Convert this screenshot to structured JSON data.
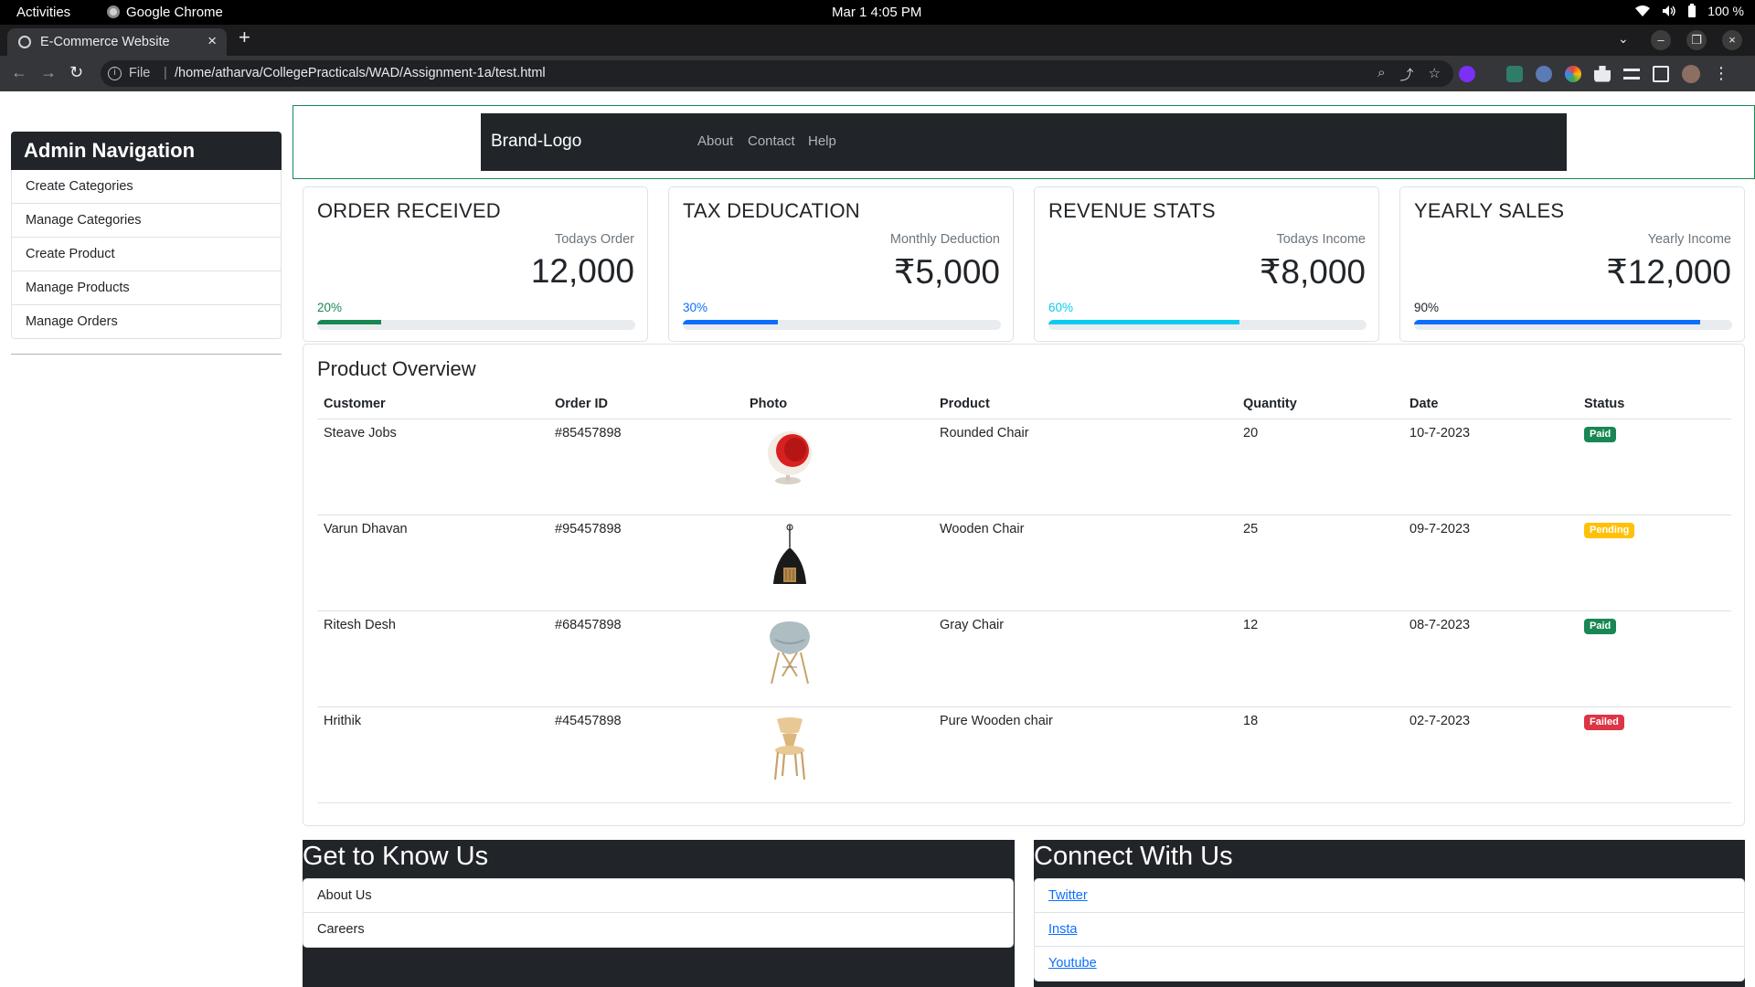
{
  "os": {
    "activities": "Activities",
    "app_name": "Google Chrome",
    "datetime": "Mar 1  4:05 PM",
    "battery": "100 %"
  },
  "browser": {
    "tab_title": "E-Commerce Website",
    "file_label": "File",
    "url": "/home/atharva/CollegePracticals/WAD/Assignment-1a/test.html"
  },
  "sidebar": {
    "title": "Admin Navigation",
    "items": [
      {
        "label": "Create Categories"
      },
      {
        "label": "Manage Categories"
      },
      {
        "label": "Create Product"
      },
      {
        "label": "Manage Products"
      },
      {
        "label": "Manage Orders"
      }
    ]
  },
  "navbar": {
    "brand": "Brand-Logo",
    "links": [
      "About",
      "Contact",
      "Help"
    ]
  },
  "cards": [
    {
      "title": "ORDER RECEIVED",
      "subtitle": "Todays Order",
      "value": "12,000",
      "percent_label": "20%",
      "percent": 20,
      "color": "#198754"
    },
    {
      "title": "TAX DEDUCATION",
      "subtitle": "Monthly Deduction",
      "value": "₹5,000",
      "percent_label": "30%",
      "percent": 30,
      "color": "#0d6efd"
    },
    {
      "title": "REVENUE STATS",
      "subtitle": "Todays Income",
      "value": "₹8,000",
      "percent_label": "60%",
      "percent": 60,
      "color": "#0dcaf0"
    },
    {
      "title": "YEARLY SALES",
      "subtitle": "Yearly Income",
      "value": "₹12,000",
      "percent_label": "90%",
      "percent": 90,
      "color": "#0d6efd"
    }
  ],
  "overview": {
    "title": "Product Overview",
    "columns": [
      "Customer",
      "Order ID",
      "Photo",
      "Product",
      "Quantity",
      "Date",
      "Status"
    ],
    "rows": [
      {
        "customer": "Steave Jobs",
        "order_id": "#85457898",
        "photo": "red-ball-chair",
        "product": "Rounded Chair",
        "quantity": "20",
        "date": "10-7-2023",
        "status": "Paid"
      },
      {
        "customer": "Varun Dhavan",
        "order_id": "#95457898",
        "photo": "black-lamp-chair",
        "product": "Wooden Chair",
        "quantity": "25",
        "date": "09-7-2023",
        "status": "Pending"
      },
      {
        "customer": "Ritesh Desh",
        "order_id": "#68457898",
        "photo": "gray-eames-chair",
        "product": "Gray Chair",
        "quantity": "12",
        "date": "08-7-2023",
        "status": "Paid"
      },
      {
        "customer": "Hrithik",
        "order_id": "#45457898",
        "photo": "wooden-chair",
        "product": "Pure Wooden chair",
        "quantity": "18",
        "date": "02-7-2023",
        "status": "Failed"
      }
    ]
  },
  "footer": {
    "know_title": "Get to Know Us",
    "know_items": [
      "About Us",
      "Careers"
    ],
    "connect_title": "Connect With Us",
    "connect_items": [
      "Twitter",
      "Insta",
      "Youtube"
    ]
  },
  "colors": {
    "dark": "#212529",
    "paid": "#198754",
    "pending": "#ffc107",
    "failed": "#dc3545",
    "link": "#0d6efd"
  }
}
